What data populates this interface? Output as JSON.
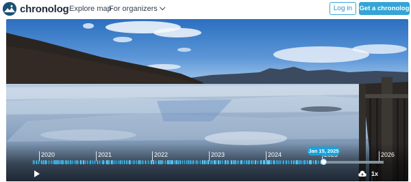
{
  "header": {
    "brand": "chronolog",
    "nav": {
      "explore": "Explore map",
      "organizers": "For organizers"
    },
    "login_label": "Log in",
    "cta_label": "Get a chronolog"
  },
  "colors": {
    "brand_blue": "#33a5d6",
    "dark_navy": "#1d4f73",
    "tooltip": "#1aa3d9"
  },
  "timeline": {
    "years": [
      "2020",
      "2021",
      "2022",
      "2023",
      "2024",
      "2025",
      "2026"
    ],
    "current_date": "Jan 15, 2025",
    "speed": "1x"
  },
  "icons": {
    "play": "play-icon",
    "upload": "upload-icon",
    "chevron": "chevron-down-icon"
  }
}
